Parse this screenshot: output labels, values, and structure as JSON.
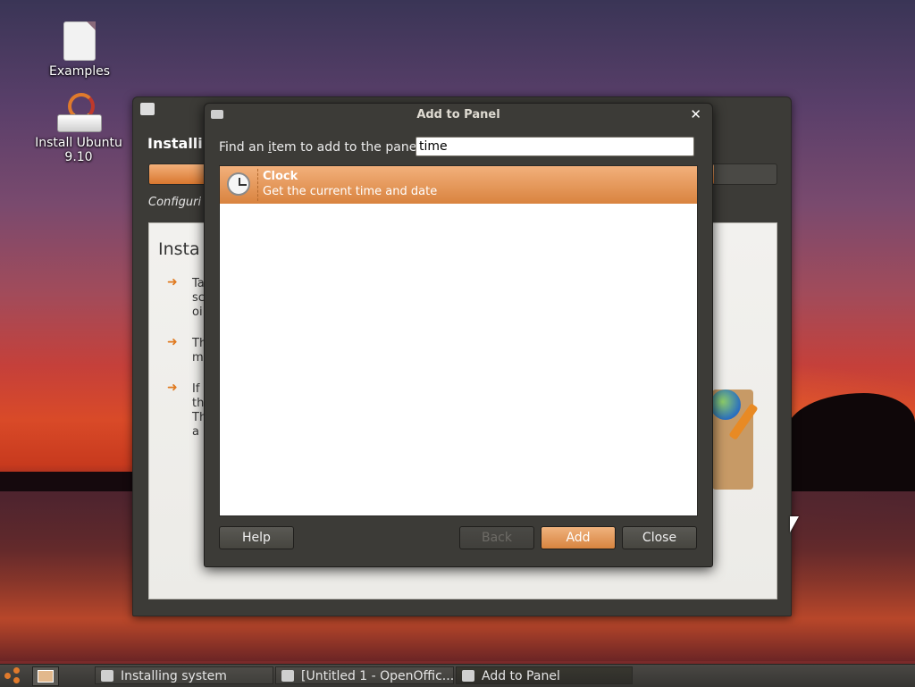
{
  "desktop": {
    "icons": [
      {
        "label": "Examples",
        "icon": "document-icon"
      },
      {
        "label": "Install Ubuntu 9.10",
        "icon": "install-drive-icon"
      }
    ]
  },
  "installer": {
    "heading": "Installi",
    "progress_fraction": 0.9,
    "status": "Configuri",
    "content_title": "Insta",
    "bullets": [
      [
        "Ta",
        "sc",
        "oi"
      ],
      [
        "Th",
        "m"
      ],
      [
        "If",
        "th",
        "Th",
        "a"
      ]
    ]
  },
  "dialog": {
    "title": "Add to Panel",
    "find_prefix": "Find an ",
    "find_mnemonic": "i",
    "find_suffix": "tem to add to the panel:",
    "search_value": "time",
    "items": [
      {
        "name": "Clock",
        "description": "Get the current time and date",
        "icon": "clock-icon",
        "selected": true
      }
    ],
    "buttons": {
      "help": "Help",
      "back": "Back",
      "add": "Add",
      "close": "Close"
    }
  },
  "taskbar": {
    "items": [
      {
        "label": "Installing system",
        "active": false
      },
      {
        "label": "[Untitled 1 - OpenOffic...",
        "active": false
      },
      {
        "label": "Add to Panel",
        "active": true
      }
    ]
  },
  "colors": {
    "accent": "#d9833f",
    "window_bg": "#3c3b37"
  }
}
